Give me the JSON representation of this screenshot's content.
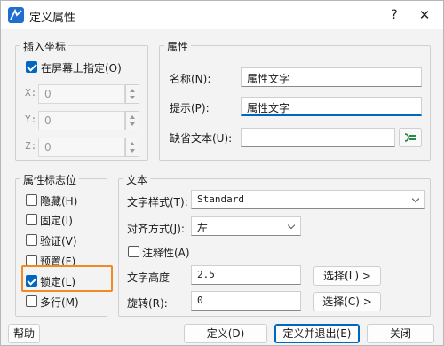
{
  "window": {
    "title": "定义属性",
    "help_glyph": "?",
    "close_glyph": "✕"
  },
  "insert_point": {
    "legend": "插入坐标",
    "on_screen_label": "在屏幕上指定(O)",
    "on_screen_checked": true,
    "x_label": "X:",
    "x_value": "0",
    "y_label": "Y:",
    "y_value": "0",
    "z_label": "Z:",
    "z_value": "0"
  },
  "attribute": {
    "legend": "属性",
    "tag_label": "名称(N):",
    "tag_value": "属性文字",
    "prompt_label": "提示(P):",
    "prompt_value": "属性文字",
    "default_label": "缺省文本(U):",
    "default_value": ""
  },
  "flags": {
    "legend": "属性标志位",
    "items": [
      {
        "label": "隐藏(H)",
        "checked": false
      },
      {
        "label": "固定(I)",
        "checked": false
      },
      {
        "label": "验证(V)",
        "checked": false
      },
      {
        "label": "预置(F)",
        "checked": false
      },
      {
        "label": "锁定(L)",
        "checked": true
      },
      {
        "label": "多行(M)",
        "checked": false
      }
    ]
  },
  "text": {
    "legend": "文本",
    "style_label": "文字样式(T):",
    "style_value": "Standard",
    "justify_label": "对齐方式(J):",
    "justify_value": "左",
    "annotative_label": "注释性(A)",
    "annotative_checked": false,
    "height_label": "文字高度",
    "height_value": "2.5",
    "height_pick": "选择(L) >",
    "rotation_label": "旋转(R):",
    "rotation_value": "0",
    "rotation_pick": "选择(C) >"
  },
  "footer": {
    "help": "帮助",
    "define": "定义(D)",
    "define_exit": "定义并退出(E)",
    "close": "关闭"
  },
  "colors": {
    "accent": "#0067c0",
    "highlight": "#f08a24"
  }
}
